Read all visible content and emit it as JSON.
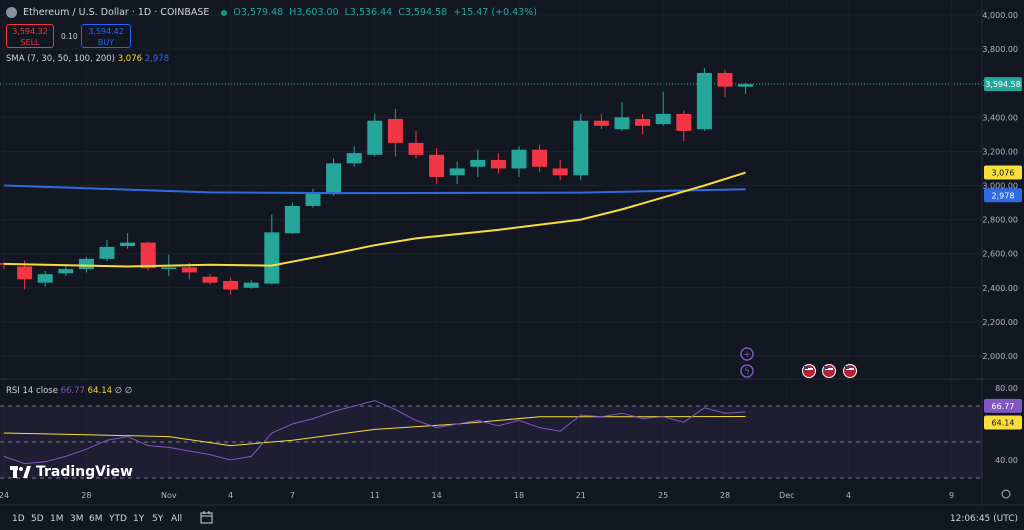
{
  "header": {
    "title": "Ethereum / U.S. Dollar · 1D · COINBASE",
    "open": "O3,579.48",
    "high": "H3,603.00",
    "low": "L3,536.44",
    "close": "C3,594.58",
    "change": "+15.47 (+0.43%)"
  },
  "trade": {
    "sell_price": "3,594.32",
    "sell_label": "SELL",
    "spread": "0.10",
    "buy_price": "3,594.42",
    "buy_label": "BUY"
  },
  "sma_legend": {
    "label": "SMA (7, 30, 50, 100, 200)",
    "v1": "3,076",
    "v2": "2,978"
  },
  "rsi_legend": {
    "label": "RSI 14 close",
    "v1": "66.77",
    "v2": "64.14",
    "e1": "∅",
    "e2": "∅"
  },
  "logo": "TradingView",
  "timeframes": [
    "1D",
    "5D",
    "1M",
    "3M",
    "6M",
    "YTD",
    "1Y",
    "5Y",
    "All"
  ],
  "clock": "12:06:45 (UTC)",
  "colors": {
    "up": "#26a69a",
    "down": "#f23645",
    "sma_yellow": "#f7de3a",
    "sma_blue": "#2f6be0",
    "rsi": "#7e57c2"
  },
  "chart_data": {
    "type": "candlestick",
    "price_axis_labels": [
      "4,000.00",
      "3,800.00",
      "3,600.00",
      "3,400.00",
      "3,200.00",
      "3,000.00",
      "2,800.00",
      "2,600.00",
      "2,400.00",
      "2,200.00",
      "2,000.00"
    ],
    "ylim": [
      1990,
      4030
    ],
    "price_tags": [
      {
        "text": "3,594.58",
        "value": 3594.58,
        "color": "#26a69a"
      },
      {
        "text": "3,076",
        "value": 3076,
        "color": "#f7de3a"
      },
      {
        "text": "2,978",
        "value": 2978,
        "color": "#2f6be0"
      }
    ],
    "x_tick_labels": [
      {
        "label": "24",
        "day": 0
      },
      {
        "label": "28",
        "day": 4
      },
      {
        "label": "Nov",
        "day": 8
      },
      {
        "label": "4",
        "day": 11
      },
      {
        "label": "7",
        "day": 14
      },
      {
        "label": "11",
        "day": 18
      },
      {
        "label": "14",
        "day": 21
      },
      {
        "label": "18",
        "day": 25
      },
      {
        "label": "21",
        "day": 28
      },
      {
        "label": "25",
        "day": 32
      },
      {
        "label": "28",
        "day": 35
      },
      {
        "label": "Dec",
        "day": 38
      },
      {
        "label": "4",
        "day": 41
      },
      {
        "label": "9",
        "day": 46
      }
    ],
    "candles": [
      {
        "day": 0,
        "o": 2545,
        "h": 2550,
        "l": 2510,
        "c": 2535
      },
      {
        "day": 1,
        "o": 2525,
        "h": 2560,
        "l": 2390,
        "c": 2450
      },
      {
        "day": 2,
        "o": 2430,
        "h": 2500,
        "l": 2410,
        "c": 2480
      },
      {
        "day": 3,
        "o": 2485,
        "h": 2530,
        "l": 2470,
        "c": 2510
      },
      {
        "day": 4,
        "o": 2510,
        "h": 2580,
        "l": 2490,
        "c": 2570
      },
      {
        "day": 5,
        "o": 2570,
        "h": 2680,
        "l": 2555,
        "c": 2640
      },
      {
        "day": 6,
        "o": 2645,
        "h": 2720,
        "l": 2630,
        "c": 2665
      },
      {
        "day": 7,
        "o": 2665,
        "h": 2670,
        "l": 2500,
        "c": 2515
      },
      {
        "day": 8,
        "o": 2510,
        "h": 2595,
        "l": 2470,
        "c": 2520
      },
      {
        "day": 9,
        "o": 2520,
        "h": 2545,
        "l": 2450,
        "c": 2490
      },
      {
        "day": 10,
        "o": 2465,
        "h": 2480,
        "l": 2420,
        "c": 2430
      },
      {
        "day": 11,
        "o": 2440,
        "h": 2460,
        "l": 2360,
        "c": 2390
      },
      {
        "day": 12,
        "o": 2400,
        "h": 2445,
        "l": 2395,
        "c": 2430
      },
      {
        "day": 13,
        "o": 2425,
        "h": 2830,
        "l": 2420,
        "c": 2725
      },
      {
        "day": 14,
        "o": 2720,
        "h": 2900,
        "l": 2715,
        "c": 2880
      },
      {
        "day": 15,
        "o": 2880,
        "h": 2980,
        "l": 2870,
        "c": 2950
      },
      {
        "day": 16,
        "o": 2950,
        "h": 3160,
        "l": 2940,
        "c": 3130
      },
      {
        "day": 17,
        "o": 3130,
        "h": 3230,
        "l": 3110,
        "c": 3190
      },
      {
        "day": 18,
        "o": 3180,
        "h": 3420,
        "l": 3170,
        "c": 3380
      },
      {
        "day": 19,
        "o": 3390,
        "h": 3450,
        "l": 3170,
        "c": 3250
      },
      {
        "day": 20,
        "o": 3250,
        "h": 3320,
        "l": 3160,
        "c": 3180
      },
      {
        "day": 21,
        "o": 3180,
        "h": 3220,
        "l": 3010,
        "c": 3050
      },
      {
        "day": 22,
        "o": 3060,
        "h": 3140,
        "l": 3010,
        "c": 3100
      },
      {
        "day": 23,
        "o": 3110,
        "h": 3210,
        "l": 3050,
        "c": 3150
      },
      {
        "day": 24,
        "o": 3150,
        "h": 3190,
        "l": 3070,
        "c": 3100
      },
      {
        "day": 25,
        "o": 3100,
        "h": 3230,
        "l": 3050,
        "c": 3210
      },
      {
        "day": 26,
        "o": 3210,
        "h": 3240,
        "l": 3080,
        "c": 3110
      },
      {
        "day": 27,
        "o": 3100,
        "h": 3150,
        "l": 3030,
        "c": 3060
      },
      {
        "day": 28,
        "o": 3060,
        "h": 3420,
        "l": 3030,
        "c": 3380
      },
      {
        "day": 29,
        "o": 3380,
        "h": 3420,
        "l": 3330,
        "c": 3350
      },
      {
        "day": 30,
        "o": 3330,
        "h": 3490,
        "l": 3320,
        "c": 3400
      },
      {
        "day": 31,
        "o": 3390,
        "h": 3420,
        "l": 3300,
        "c": 3350
      },
      {
        "day": 32,
        "o": 3360,
        "h": 3550,
        "l": 3350,
        "c": 3420
      },
      {
        "day": 33,
        "o": 3420,
        "h": 3440,
        "l": 3260,
        "c": 3320
      },
      {
        "day": 34,
        "o": 3330,
        "h": 3690,
        "l": 3320,
        "c": 3660
      },
      {
        "day": 35,
        "o": 3660,
        "h": 3680,
        "l": 3520,
        "c": 3580
      },
      {
        "day": 36,
        "o": 3579.48,
        "h": 3603,
        "l": 3536.44,
        "c": 3594.58
      }
    ],
    "sma_yellow": [
      [
        0,
        2540
      ],
      [
        6,
        2525
      ],
      [
        10,
        2535
      ],
      [
        13,
        2530
      ],
      [
        16,
        2600
      ],
      [
        18,
        2650
      ],
      [
        20,
        2690
      ],
      [
        24,
        2740
      ],
      [
        28,
        2800
      ],
      [
        30,
        2860
      ],
      [
        32,
        2930
      ],
      [
        34,
        3000
      ],
      [
        36,
        3076
      ]
    ],
    "sma_blue": [
      [
        0,
        3000
      ],
      [
        10,
        2960
      ],
      [
        16,
        2955
      ],
      [
        28,
        2958
      ],
      [
        36,
        2978
      ]
    ],
    "rsi": {
      "axis_labels": [
        "80.00",
        "40.00"
      ],
      "ylim": [
        30,
        85
      ],
      "levels": [
        70,
        50,
        30
      ],
      "tags": [
        {
          "text": "66.77",
          "value": 66.77
        },
        {
          "text": "64.14",
          "value": 64.14
        }
      ],
      "rsi_line": [
        [
          0,
          42
        ],
        [
          1,
          38
        ],
        [
          2,
          39
        ],
        [
          3,
          42
        ],
        [
          4,
          46
        ],
        [
          5,
          51
        ],
        [
          6,
          53
        ],
        [
          7,
          48
        ],
        [
          8,
          47
        ],
        [
          9,
          45
        ],
        [
          10,
          43
        ],
        [
          11,
          40
        ],
        [
          12,
          42
        ],
        [
          13,
          55
        ],
        [
          14,
          60
        ],
        [
          15,
          63
        ],
        [
          16,
          67
        ],
        [
          17,
          70
        ],
        [
          18,
          73
        ],
        [
          19,
          68
        ],
        [
          20,
          62
        ],
        [
          21,
          58
        ],
        [
          22,
          60
        ],
        [
          23,
          62
        ],
        [
          24,
          59
        ],
        [
          25,
          62
        ],
        [
          26,
          58
        ],
        [
          27,
          56
        ],
        [
          28,
          65
        ],
        [
          29,
          64
        ],
        [
          30,
          66
        ],
        [
          31,
          63
        ],
        [
          32,
          64
        ],
        [
          33,
          61
        ],
        [
          34,
          69
        ],
        [
          35,
          66
        ],
        [
          36,
          66.77
        ]
      ],
      "signal_line": [
        [
          0,
          55
        ],
        [
          4,
          54
        ],
        [
          8,
          53
        ],
        [
          11,
          48
        ],
        [
          14,
          51
        ],
        [
          18,
          57
        ],
        [
          22,
          60
        ],
        [
          26,
          64
        ],
        [
          30,
          64
        ],
        [
          36,
          64.14
        ]
      ]
    }
  }
}
